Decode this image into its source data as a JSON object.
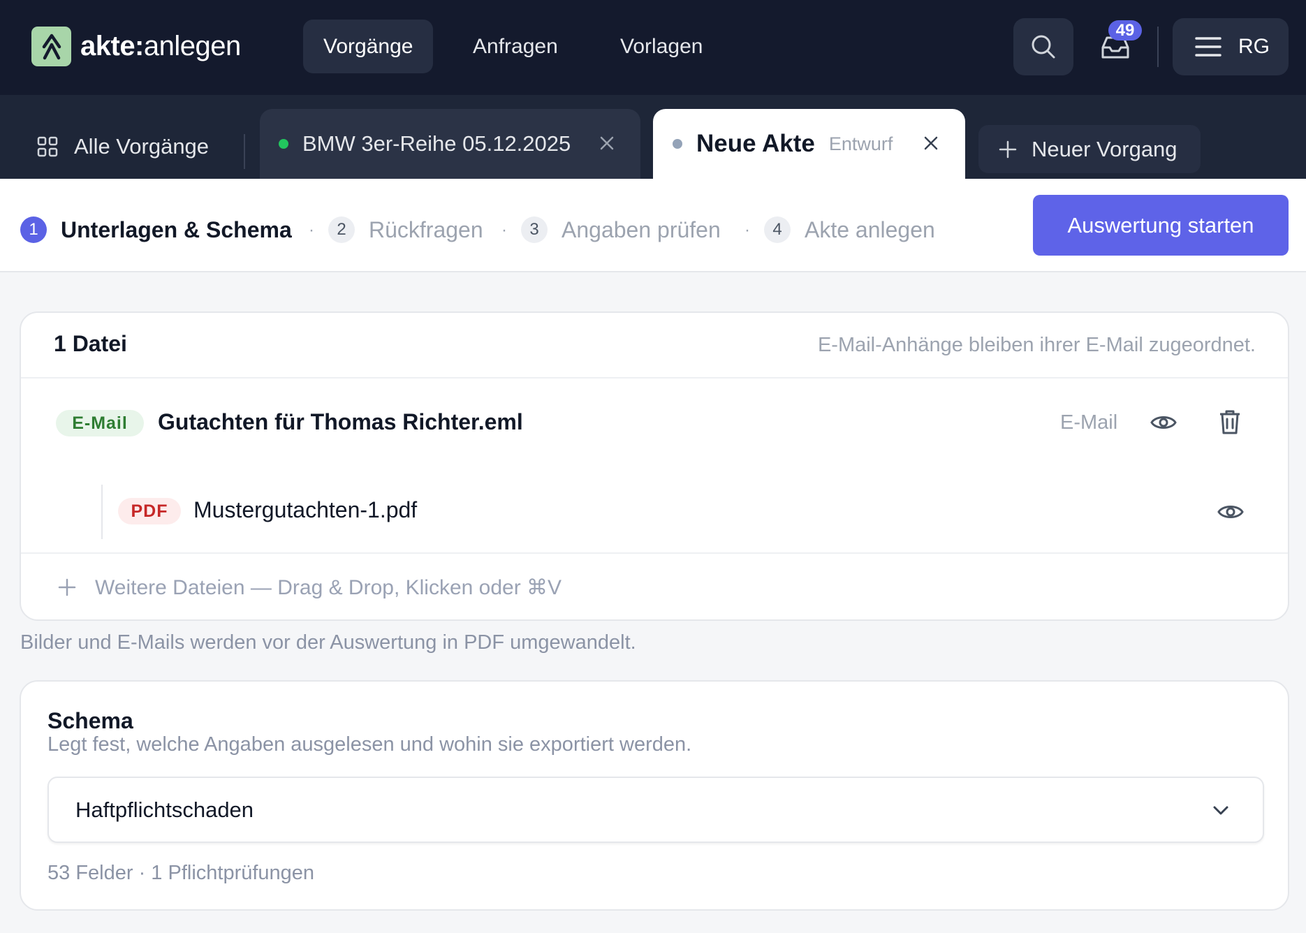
{
  "app": {
    "brand_bold": "akte:",
    "brand_light": "anlegen"
  },
  "nav": {
    "items": [
      {
        "label": "Vorgänge"
      },
      {
        "label": "Anfragen"
      },
      {
        "label": "Vorlagen"
      }
    ]
  },
  "inbox": {
    "count": "49"
  },
  "user": {
    "initials": "RG"
  },
  "tabs": {
    "all_label": "Alle Vorgänge",
    "open": [
      {
        "title": "BMW 3er-Reihe 05.12.2025",
        "status_color": "#22c55e"
      },
      {
        "title": "Neue Akte",
        "status": "Entwurf",
        "status_color": "#94a3b8"
      }
    ],
    "new_label": "Neuer Vorgang"
  },
  "stepper": {
    "steps": [
      {
        "num": "1",
        "label": "Unterlagen & Schema"
      },
      {
        "num": "2",
        "label": "Rückfragen"
      },
      {
        "num": "3",
        "label": "Angaben prüfen"
      },
      {
        "num": "4",
        "label": "Akte anlegen"
      }
    ],
    "separator": "·",
    "primary_action": "Auswertung starten"
  },
  "files": {
    "count_label": "1 Datei",
    "hint": "E-Mail-Anhänge bleiben ihrer E-Mail zugeordnet.",
    "items": [
      {
        "tag": "E-Mail",
        "name": "Gutachten für Thomas Richter.eml",
        "type": "E-Mail"
      },
      {
        "tag": "PDF",
        "name": "Mustergutachten-1.pdf"
      }
    ],
    "drop_label": "Weitere Dateien — Drag & Drop, Klicken oder ⌘V",
    "note": "Bilder und E-Mails werden vor der Auswertung in PDF umgewandelt."
  },
  "schema": {
    "title": "Schema",
    "description": "Legt fest, welche Angaben ausgelesen und wohin sie exportiert werden.",
    "selected": "Haftpflichtschaden",
    "meta": "53 Felder · 1 Pflichtprüfungen"
  },
  "colors": {
    "accent": "#5e63e8",
    "nav_bg": "#141a2d",
    "tab_bg": "#1e2638",
    "logo_bg": "#a8d5a9"
  }
}
